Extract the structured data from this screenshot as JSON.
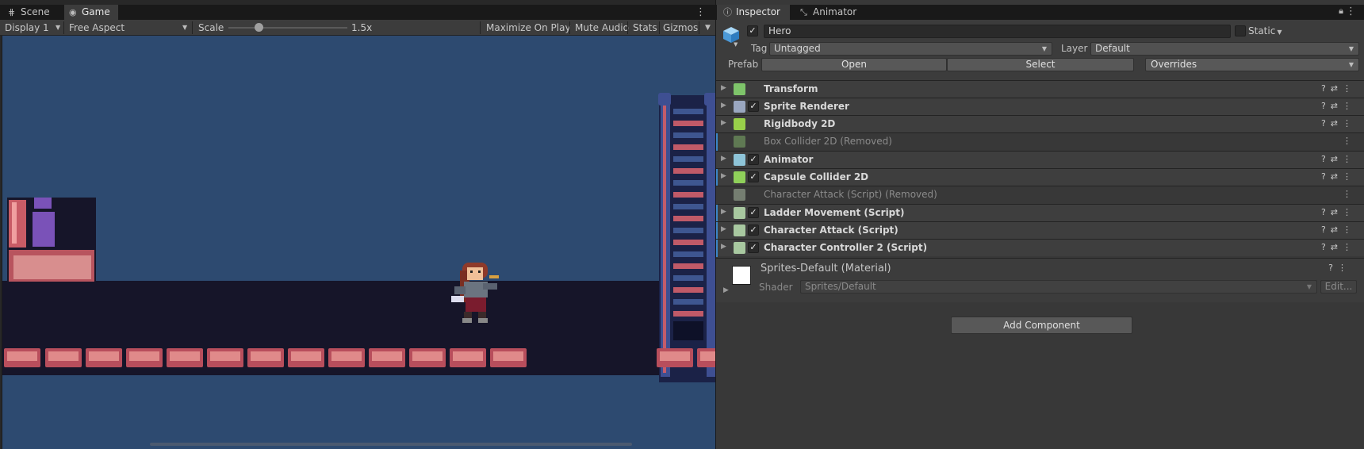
{
  "left_tabs": {
    "scene": "Scene",
    "game": "Game"
  },
  "game_toolbar": {
    "display": "Display 1",
    "aspect": "Free Aspect",
    "scale_label": "Scale",
    "scale_value": "1.5x",
    "scale_fraction": 0.25,
    "maximize": "Maximize On Play",
    "mute": "Mute Audio",
    "stats": "Stats",
    "gizmos": "Gizmos"
  },
  "right_tabs": {
    "inspector": "Inspector",
    "animator": "Animator"
  },
  "object": {
    "name": "Hero",
    "active": true,
    "static_label": "Static",
    "tag_label": "Tag",
    "tag_value": "Untagged",
    "layer_label": "Layer",
    "layer_value": "Default",
    "prefab_label": "Prefab",
    "prefab_open": "Open",
    "prefab_select": "Select",
    "prefab_overrides": "Overrides"
  },
  "components": [
    {
      "label": "Transform",
      "checkbox": false,
      "removed": false,
      "icon": "transform-icon",
      "color": "#7ec46a"
    },
    {
      "label": "Sprite Renderer",
      "checkbox": true,
      "removed": false,
      "icon": "sprite-renderer-icon",
      "color": "#9aa7c0"
    },
    {
      "label": "Rigidbody 2D",
      "checkbox": false,
      "removed": false,
      "icon": "rigidbody-icon",
      "color": "#98d04a"
    },
    {
      "label": "Box Collider 2D (Removed)",
      "checkbox": false,
      "removed": true,
      "icon": "box-collider-icon",
      "color": "#7fae6a"
    },
    {
      "label": "Animator",
      "checkbox": true,
      "removed": false,
      "icon": "animator-icon",
      "color": "#8ec4d8"
    },
    {
      "label": "Capsule Collider 2D",
      "checkbox": true,
      "removed": false,
      "icon": "capsule-collider-icon",
      "color": "#8fd05a"
    },
    {
      "label": "Character Attack (Script) (Removed)",
      "checkbox": false,
      "removed": true,
      "icon": "script-icon",
      "color": "#a8b8a0"
    },
    {
      "label": "Ladder Movement (Script)",
      "checkbox": true,
      "removed": false,
      "icon": "script-icon",
      "color": "#a8c8a0"
    },
    {
      "label": "Character Attack (Script)",
      "checkbox": true,
      "removed": false,
      "icon": "script-icon",
      "color": "#a8c8a0"
    },
    {
      "label": "Character Controller 2 (Script)",
      "checkbox": true,
      "removed": false,
      "icon": "script-icon",
      "color": "#a8c8a0"
    }
  ],
  "material": {
    "name": "Sprites-Default (Material)",
    "shader_label": "Shader",
    "shader_value": "Sprites/Default",
    "edit": "Edit..."
  },
  "add_component": "Add Component"
}
